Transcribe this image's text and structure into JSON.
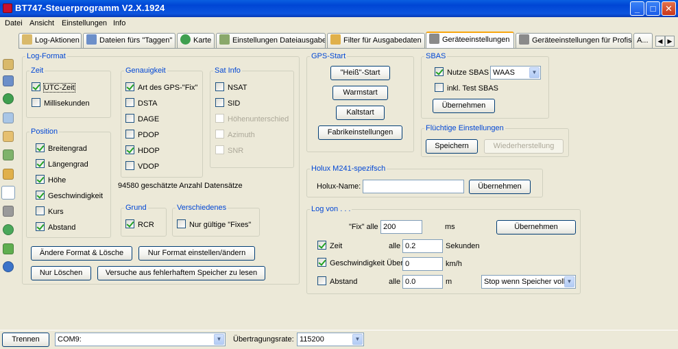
{
  "window": {
    "title": "BT747-Steuerprogramm V2.X.1924",
    "min": "_",
    "max": "□",
    "close": "✕"
  },
  "menu": [
    "Datei",
    "Ansicht",
    "Einstellungen",
    "Info"
  ],
  "tabs": [
    {
      "label": "Log-Aktionen",
      "icon": "home-icon",
      "color": "#d9b96a"
    },
    {
      "label": "Dateien fürs \"Taggen\"",
      "icon": "photos-icon",
      "color": "#6c8fc9"
    },
    {
      "label": "Karte",
      "icon": "globe-icon",
      "color": "#3f9f4f"
    },
    {
      "label": "Einstellungen Dateiausgabe",
      "icon": "document-icon",
      "color": "#8aa86b"
    },
    {
      "label": "Filter für Ausgabedaten",
      "icon": "hourglass-icon",
      "color": "#e0b04a"
    },
    {
      "label": "Geräteeinstellungen",
      "icon": "wrench-icon",
      "color": "#8a8a8a"
    },
    {
      "label": "Geräteeinstellungen für Profis",
      "icon": "tools-plus-icon",
      "color": "#8a8a8a"
    },
    {
      "label": "A...",
      "icon": "",
      "color": ""
    }
  ],
  "tab_scroll": {
    "left": "◀",
    "right": "▶"
  },
  "sidebar_icons": [
    "home-icon",
    "photos-icon",
    "globe-icon",
    "document-icon",
    "pen-icon",
    "upload-icon",
    "hourglass-icon",
    "wrench-icon",
    "tools-plus-icon",
    "recycle-icon",
    "export-icon",
    "info-icon"
  ],
  "log_format": {
    "title": "Log-Format",
    "zeit": {
      "title": "Zeit",
      "utc": "UTC-Zeit",
      "ms": "Millisekunden"
    },
    "genauigkeit": {
      "title": "Genauigkeit",
      "items": [
        "Art des GPS-\"Fix\"",
        "DSTA",
        "DAGE",
        "PDOP",
        "HDOP",
        "VDOP"
      ]
    },
    "satinfo": {
      "title": "Sat Info",
      "items": [
        "NSAT",
        "SID",
        "Höhenunterschied",
        "Azimuth",
        "SNR"
      ]
    },
    "position": {
      "title": "Position",
      "items": [
        "Breitengrad",
        "Längengrad",
        "Höhe",
        "Geschwindigkeit",
        "Kurs",
        "Abstand"
      ]
    },
    "estimate": "94580 geschätzte Anzahl Datensätze",
    "grund": {
      "title": "Grund",
      "rcr": "RCR"
    },
    "verschiedenes": {
      "title": "Verschiedenes",
      "fixes": "Nur gültige \"Fixes\""
    },
    "buttons": {
      "change_delete": "Ändere Format & Lösche",
      "set_only": "Nur Format einstellen/ändern",
      "delete_only": "Nur Löschen",
      "recover": "Versuche aus fehlerhaftem Speicher zu lesen"
    }
  },
  "gps_start": {
    "title": "GPS-Start",
    "hot": "\"Heiß\"-Start",
    "warm": "Warmstart",
    "cold": "Kaltstart",
    "factory": "Fabrikeinstellungen"
  },
  "sbas": {
    "title": "SBAS",
    "use": "Nutze SBAS",
    "type": "WAAS",
    "test": "inkl. Test SBAS",
    "apply": "Übernehmen"
  },
  "volatile": {
    "title": "Flüchtige Einstellungen",
    "save": "Speichern",
    "restore": "Wiederherstellung"
  },
  "holux": {
    "title": "Holux M241-spezifsch",
    "name_label": "Holux-Name:",
    "name_value": "",
    "apply": "Übernehmen"
  },
  "log_by": {
    "title": "Log von . . .",
    "fix_label": "\"Fix\" alle",
    "fix_value": "200",
    "fix_unit": "ms",
    "apply": "Übernehmen",
    "time_label": "Zeit",
    "time_every": "alle",
    "time_value": "0.2",
    "time_unit": "Sekunden",
    "speed_label": "Geschwindigkeit Über",
    "speed_value": "0",
    "speed_unit": "km/h",
    "dist_label": "Abstand",
    "dist_every": "alle",
    "dist_value": "0.0",
    "dist_unit": "m",
    "stop_option": "Stop wenn Speicher voll"
  },
  "status": {
    "disconnect": "Trennen",
    "port": "COM9:",
    "rate_label": "Übertragungsrate:",
    "rate": "115200"
  }
}
